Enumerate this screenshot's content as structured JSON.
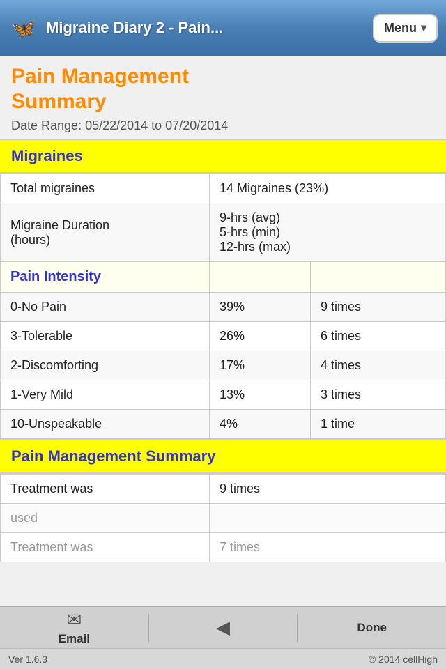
{
  "header": {
    "app_icon": "🦋",
    "title": "Migraine Diary 2 - Pain...",
    "menu_label": "Menu"
  },
  "page": {
    "title_line1": "Pain Management",
    "title_line2": "Summary",
    "date_range": "Date Range: 05/22/2014 to 07/20/2014"
  },
  "migraines_section": {
    "header": "Migraines",
    "rows": [
      {
        "label": "Total migraines",
        "value": "14 Migraines (23%)"
      },
      {
        "label": "Migraine Duration\n(hours)",
        "value": "9-hrs (avg)\n5-hrs (min)\n12-hrs (max)"
      }
    ],
    "pain_intensity_header": "Pain Intensity",
    "pain_rows": [
      {
        "label": "0-No Pain",
        "pct": "39%",
        "count": "9 times"
      },
      {
        "label": "3-Tolerable",
        "pct": "26%",
        "count": "6 times"
      },
      {
        "label": "2-Discomforting",
        "pct": "17%",
        "count": "4 times"
      },
      {
        "label": "1-Very Mild",
        "pct": "13%",
        "count": "3 times"
      },
      {
        "label": "10-Unspeakable",
        "pct": "4%",
        "count": "1 time"
      }
    ]
  },
  "pain_mgmt_section": {
    "header": "Pain Management Summary",
    "rows": [
      {
        "label": "Treatment was",
        "value": "9 times"
      },
      {
        "label": "used",
        "value": ""
      },
      {
        "label": "Treatment was",
        "value": "7 times"
      }
    ]
  },
  "toolbar": {
    "email_label": "Email",
    "done_label": "Done"
  },
  "footer": {
    "version": "Ver 1.6.3",
    "copyright": "© 2014 cellHigh"
  }
}
